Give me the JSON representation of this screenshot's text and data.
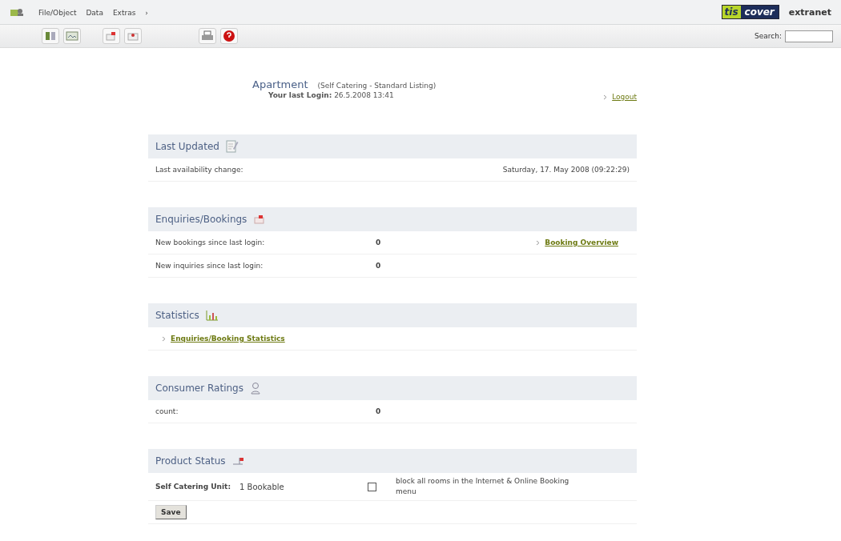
{
  "menu": [
    "File/Object",
    "Data",
    "Extras",
    "›"
  ],
  "brand": {
    "logo": [
      "tis",
      "cover"
    ],
    "label": "extranet"
  },
  "search": {
    "label": "Search:"
  },
  "header": {
    "title": "Apartment",
    "subtitle": "(Self Catering - Standard Listing)",
    "login": "**Your last Login:** 26.5.2008  13:41",
    "logout": "Logout"
  },
  "sections": [
    {
      "kind": "updated",
      "title": "Last Updated",
      "rows": [
        {
          "label": "Last availability change:",
          "value": "Saturday, 17. May 2008 (09:22:29)"
        }
      ]
    },
    {
      "kind": "bookings",
      "title": "Enquiries/Bookings",
      "rows": [
        {
          "label": "New bookings since last login:",
          "value": "0",
          "link": "Booking Overview"
        },
        {
          "label": "New inquiries since last login:",
          "value": "0"
        }
      ]
    },
    {
      "kind": "statistics",
      "title": "Statistics",
      "links": [
        "Enquiries/Booking Statistics"
      ]
    },
    {
      "kind": "ratings",
      "title": "Consumer Ratings",
      "rows": [
        {
          "label": "count:",
          "value": "0"
        }
      ]
    },
    {
      "kind": "status",
      "title": "Product Status",
      "unit_label": "Self Catering Unit:",
      "unit_value": "1 Bookable",
      "checkbox": {
        "checked": false,
        "label": "block all rooms in the Internet & Online Booking menu"
      },
      "button": "Save"
    }
  ]
}
